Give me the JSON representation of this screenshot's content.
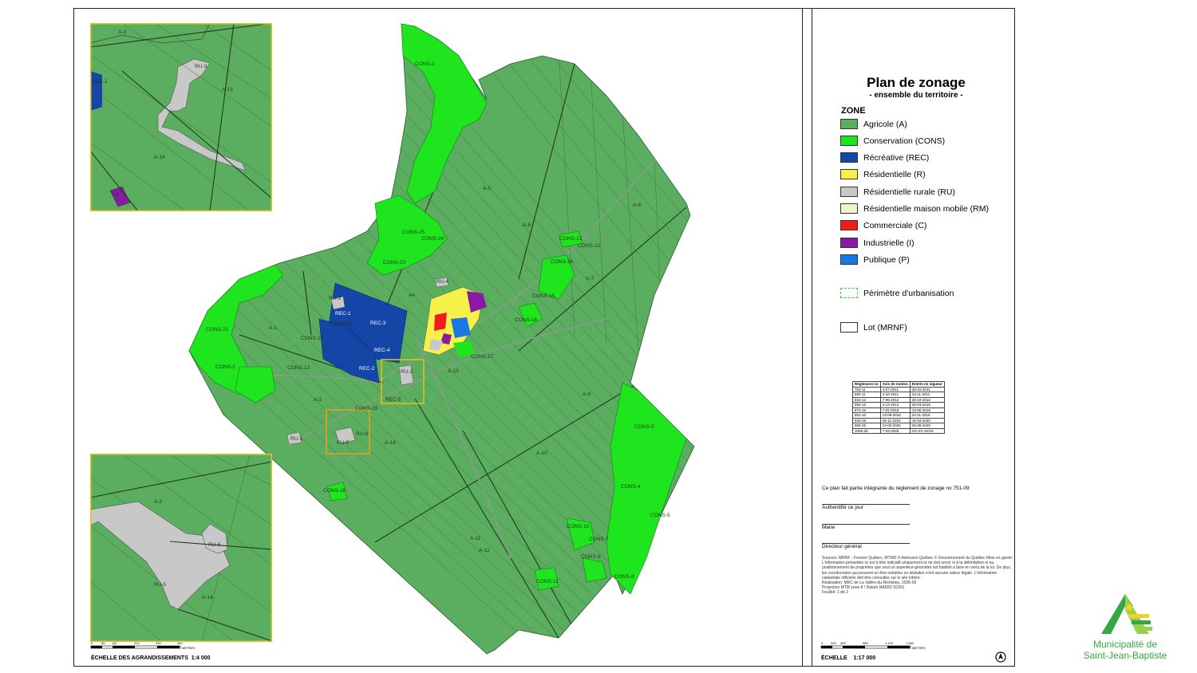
{
  "legend": {
    "title": "Plan de zonage",
    "subtitle": "- ensemble du territoire -",
    "zone_heading": "ZONE",
    "items": [
      {
        "label": "Agricole (A)",
        "color": "#5bae5f"
      },
      {
        "label": "Conservation (CONS)",
        "color": "#1fe51f"
      },
      {
        "label": "Récréative (REC)",
        "color": "#1446a8"
      },
      {
        "label": "Résidentielle (R)",
        "color": "#f6f04a"
      },
      {
        "label": "Résidentielle rurale (RU)",
        "color": "#c8c8c8"
      },
      {
        "label": "Résidentielle maison mobile (RM)",
        "color": "#eaf7c8"
      },
      {
        "label": "Commerciale (C)",
        "color": "#ee1c1c"
      },
      {
        "label": "Industrielle (I)",
        "color": "#8a1aa3"
      },
      {
        "label": "Publique (P)",
        "color": "#1a78e6"
      }
    ],
    "perimeter_label": "Périmètre d'urbanisation",
    "lot_label": "Lot (MRNF)"
  },
  "reg_table": {
    "headers": [
      "Règlement no",
      "Avis de motion",
      "Entrée en vigueur"
    ],
    "rows": [
      [
        "763-11",
        "4-07-2011",
        "28-10-2011"
      ],
      [
        "800-11",
        "4-10-2011",
        "24-11-2011"
      ],
      [
        "815-12",
        "7-06-2012",
        "26-10-2012"
      ],
      [
        "856-15",
        "2-12-2014",
        "30-03-2015"
      ],
      [
        "874-16",
        "7-02-2016",
        "10-06-2016"
      ],
      [
        "891-16",
        "13-09-2016",
        "24-11-2016"
      ],
      [
        "933-19",
        "26-11-2019",
        "16-04-2020"
      ],
      [
        "995-25",
        "13-02-2025",
        "26-09-2025"
      ],
      [
        "1006-26",
        "7-04-2026",
        "XX-XX-XXXX"
      ]
    ]
  },
  "notes": {
    "integral": "Ce plan fait partie intégrante du règlement de zonage no 751-09",
    "authentic": "Authentifié ce jour",
    "mayor": "Maire",
    "director": "Directeur général",
    "credits": "Sources: MRNF - Foncier Québec, MTMD © Adresses Québec © Gouvernement du Québec Mise en garde: L'information présentée ici est à titre indicatif uniquement et ne doit servir ni à la délimitation ni au positionnement de propriétés que seul un arpenteur-géomètre est habilité à faire en vertu de la loi. De plus, les coordonnées qui peuvent en être extraites ou déduites n'ont aucune valeur légale. L'information cadastrale officielle doit être consultée sur le site Infolot.",
    "realisation": "Réalisation: MRC de La Vallée-du-Richelieu, 2026-05",
    "projection": "Projection MTM zone 8 / Datum NAD83 SCRS",
    "sheet": "Feuillet: 1 de 2"
  },
  "scales": {
    "enlargement_label": "ÉCHELLE DES AGRANDISSEMENTS",
    "enlargement_value": "1:4 000",
    "main_label": "ÉCHELLE",
    "main_value": "1:17 000",
    "units": "MÈTRES",
    "enlargement_ticks": [
      "0",
      "55",
      "110",
      "220",
      "330",
      "440"
    ],
    "main_ticks": [
      "0",
      "245",
      "490",
      "980",
      "1 470",
      "1 960"
    ]
  },
  "map_labels": {
    "cons": [
      "CONS-1",
      "CONS-25",
      "CONS-24",
      "CONS-23",
      "CONS-21",
      "CONS-22",
      "CONS-20",
      "CONS-2",
      "CONS-13",
      "CONS-19",
      "CONS-18",
      "CONS-13",
      "CONS-12",
      "CONS-14",
      "CONS-15",
      "CONS-16",
      "CONS-17",
      "CONS-3",
      "CONS-4",
      "CONS-5",
      "CONS-10",
      "CONS-7",
      "CONS-9",
      "CONS-8",
      "CONS-11"
    ],
    "agri": [
      "A-5",
      "A-6",
      "A-8",
      "A-7",
      "A4",
      "A-1",
      "A-13",
      "A-9",
      "A-2",
      "A-14",
      "A-10",
      "A-11",
      "A-12"
    ],
    "rec": [
      "REC-3",
      "REC-1",
      "REC-4",
      "REC-2",
      "REC-5"
    ],
    "ru": [
      "RU-3",
      "RU-2",
      "RU-1",
      "RU-5",
      "RU-6",
      "RU-4"
    ],
    "inset1": [
      "A-3",
      "RU-3",
      "A-13",
      "REC-1",
      "A-14",
      "I-5"
    ],
    "inset2": [
      "A-2",
      "RU-6",
      "RU-5",
      "A-14"
    ]
  },
  "logo": {
    "line1": "Municipalité de",
    "line2": "Saint-Jean-Baptiste"
  }
}
